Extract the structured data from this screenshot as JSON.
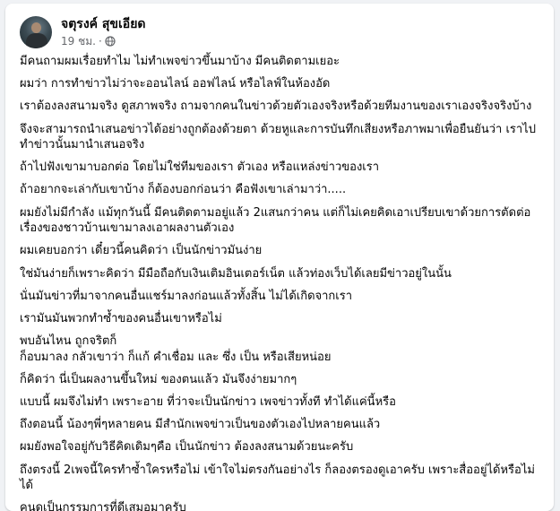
{
  "post": {
    "author": "จตุรงค์ สุขเอียด",
    "time": "19 ชม.",
    "dot": "·",
    "privacy_icon": "globe-icon",
    "paragraphs": [
      "มีคนถามผมเรื่อยทำไม ไม่ทำเพจข่าวขึ้นมาบ้าง มีคนติดตามเยอะ",
      "ผมว่า การทำข่าวไม่ว่าจะออนไลน์ ออฟไลน์ หรือไลฟ์ในห้องอัด",
      "เราต้องลงสนามจริง ดูสภาพจริง ถามจากคนในข่าวด้วยตัวเองจริงหรือด้วยทีมงานของเราเองจริงจริงบ้าง",
      "จึงจะสามารถนำเสนอข่าวได้อย่างถูกต้องด้วยตา ด้วยหูและการบันทึกเสียงหรือภาพมาเพื่อยืนยันว่า เราไปทำข่าวนั้นมานำเสนอจริง",
      "ถ้าไปฟังเขามาบอกต่อ โดยไม่ใช่ทีมของเรา ตัวเอง หรือแหล่งข่าวของเรา",
      "ถ้าอยากจะเล่ากับเขาบ้าง ก็ต้องบอกก่อนว่า คือฟังเขาเล่ามาว่า.....",
      " ผมยังไม่มีกำลัง แม้ทุกวันนี้ มีคนติดตามอยู่แล้ว 2แสนกว่าคน แต่ก็ไม่เคยคิดเอาเปรียบเขาด้วยการตัดต่อเรื่องของชาวบ้านเขามาลงเอาผลงานตัวเอง",
      "ผมเคยบอกว่า เดี๋ยวนี้คนคิดว่า เป็นนักข่าวมันง่าย",
      "ใช่มันง่ายก็เพราะคิดว่า มีมือถือกับเงินเติมอินเตอร์เน็ต แล้วท่องเว็บได้เลยมีข่าวอยู่ในนั้น",
      "นั่นมันข่าวที่มาจากคนอื่นแชร์มาลงก่อนแล้วทั้งสิ้น ไม่ได้เกิดจากเรา",
      "เรามันมันพวกทำซ้ำของคนอื่นเขาหรือไม่",
      "พบอันไหน ถูกจริตก็\nก็อบมาลง  กลัวเขาว่า ก็แก้ คำเชื่อม และ ซึ่ง เป็น หรือเสียหน่อย",
      " ก็คิดว่า นี่เป็นผลงานขึ้นใหม่ ของตนแล้ว มันจึงง่ายมากๆ",
      "แบบนี้ ผมจึงไม่ทำ เพราะอาย ที่ว่าจะเป็นนักข่าว เพจข่าวทั้งที ทำได้แค่นี้หรือ",
      "ถึงตอนนี้ น้องๆพี่ๆหลายคน มีสำนักเพจข่าวเป็นของตัวเองไปหลายคนแล้ว",
      "ผมยังพอใจอยู่กับวิธีคิดเดิมๆคือ เป็นนักข่าว ต้องลงสนามด้วยนะครับ",
      "ถึงตรงนี้ 2เพจนี้ใครทำซ้ำใครหรือไม่ เข้าใจไม่ตรงกันอย่างไร  ก็ลองตรองดูเอาครับ เพราะสื่ออยู่ได้หรือไม่ได้",
      "คนดูเป็นกรรมการที่ดีเสมอมาครับ"
    ]
  }
}
